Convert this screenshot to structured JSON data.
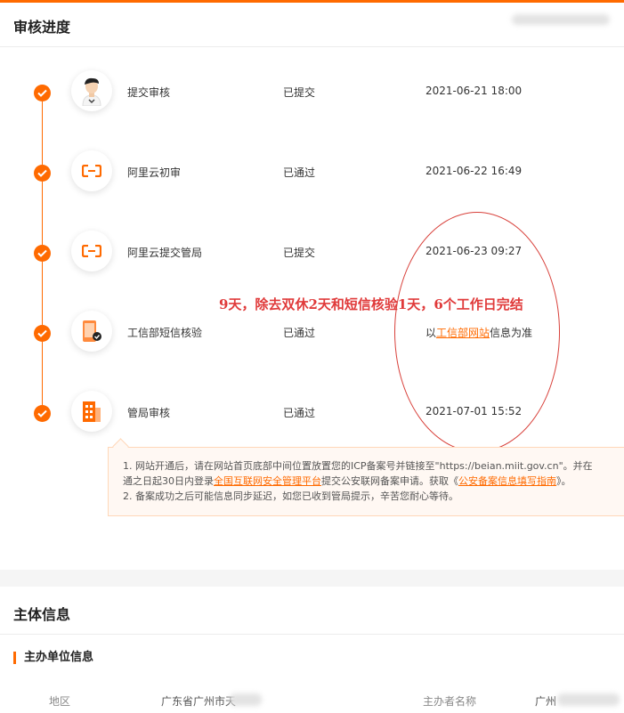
{
  "header": {
    "title": "审核进度"
  },
  "steps": [
    {
      "name": "提交审核",
      "status": "已提交",
      "time": "2021-06-21 18:00",
      "icon": "person-avatar-icon"
    },
    {
      "name": "阿里云初审",
      "status": "已通过",
      "time": "2021-06-22 16:49",
      "icon": "aliyun-logo-icon"
    },
    {
      "name": "阿里云提交管局",
      "status": "已提交",
      "time": "2021-06-23 09:27",
      "icon": "aliyun-logo-icon"
    },
    {
      "name": "工信部短信核验",
      "status": "已通过",
      "time_prefix": "以",
      "time_link": "工信部网站",
      "time_suffix": "信息为准",
      "icon": "phone-verify-icon"
    },
    {
      "name": "管局审核",
      "status": "已通过",
      "time": "2021-07-01 15:52",
      "icon": "building-icon"
    }
  ],
  "annotation": "9天，除去双休2天和短信核验1天，6个工作日完结",
  "notice": {
    "line1": "1. 网站开通后，请在网站首页底部中间位置放置您的ICP备案号并链接至\"https://beian.miit.gov.cn\"。并在",
    "line2_prefix": "通之日起30日内登录",
    "line2_link1": "全国互联网安全管理平台",
    "line2_middle": "提交公安联网备案申请。获取《",
    "line2_link2": "公安备案信息填写指南",
    "line2_suffix": "》。",
    "line3": "2. 备案成功之后可能信息同步延迟，如您已收到管局提示，辛苦您耐心等待。"
  },
  "entity": {
    "title": "主体信息",
    "sub_title": "主办单位信息",
    "region_label": "地区",
    "region_value": "广东省广州市天",
    "owner_label": "主办者名称",
    "owner_value": "广州"
  },
  "colors": {
    "accent": "#ff6a00",
    "annotation": "#e03a3a"
  }
}
